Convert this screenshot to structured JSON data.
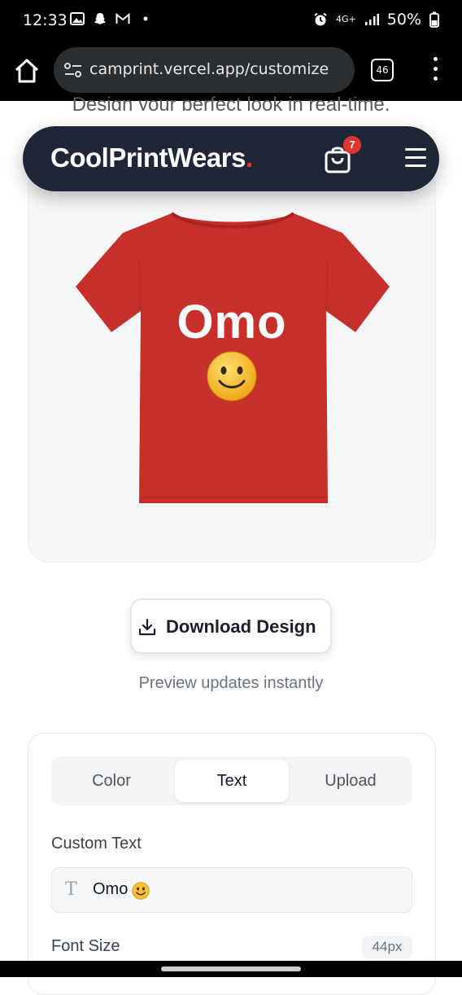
{
  "status_bar": {
    "time": "12:33",
    "network": "4G+",
    "battery": "50%"
  },
  "browser": {
    "url": "camprint.vercel.app/customize",
    "tab_count": "46"
  },
  "page": {
    "subtitle": "Design your perfect look in real-time."
  },
  "navbar": {
    "logo_text": "CoolPrintWears",
    "logo_dot": ".",
    "cart_count": "7"
  },
  "preview": {
    "shirt_color": "#c7302a",
    "shirt_text": "Omo",
    "shirt_emoji": "smiley-face"
  },
  "download": {
    "label": "Download Design",
    "note": "Preview updates instantly"
  },
  "controls": {
    "tabs": [
      {
        "label": "Color",
        "active": false
      },
      {
        "label": "Text",
        "active": true
      },
      {
        "label": "Upload",
        "active": false
      }
    ],
    "custom_text_label": "Custom Text",
    "custom_text_value": "Omo",
    "font_size_label": "Font Size",
    "font_size_value": "44px"
  },
  "colors": {
    "navbar_bg": "#1f2638",
    "accent": "#e03a3a",
    "badge": "#e0352f"
  }
}
